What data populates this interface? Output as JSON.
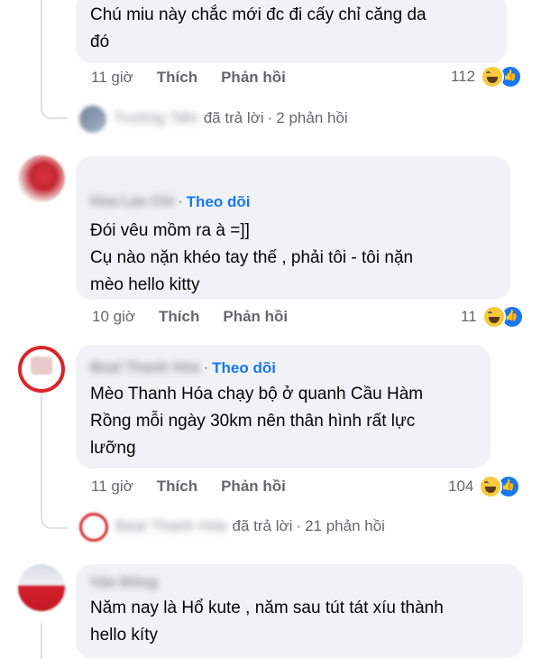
{
  "comments": [
    {
      "text_lines": [
        "Chú miu này chắc mới đc đi cấy chỉ căng da",
        "đó"
      ],
      "time": "11 giờ",
      "like": "Thích",
      "reply": "Phản hồi",
      "reaction_count": "112"
    },
    {
      "author": "Hoa Lan Chi",
      "follow": "Theo dõi",
      "text_lines": [
        "Đói vêu mồm ra à =]]",
        "Cụ nào nặn khéo tay thế , phải tôi - tôi nặn",
        "mèo hello kitty"
      ],
      "time": "10 giờ",
      "like": "Thích",
      "reply": "Phản hồi",
      "reaction_count": "11"
    },
    {
      "author": "Beat Thanh Hóa",
      "follow": "Theo dõi",
      "text_lines": [
        "Mèo Thanh Hóa chạy bộ ở quanh Cầu Hàm",
        "Rồng mỗi ngày 30km nên thân hình rất lực",
        "lưỡng"
      ],
      "time": "11 giờ",
      "like": "Thích",
      "reply": "Phản hồi",
      "reaction_count": "104"
    },
    {
      "author": "Văn Đông",
      "text_lines": [
        "Năm nay là Hổ kute , năm sau tút tát xíu thành",
        "hello kíty"
      ]
    }
  ],
  "reply_summaries": [
    {
      "name": "Trường Tiến",
      "replied": "đã trả lời",
      "count": "2 phản hồi"
    },
    {
      "name": "Beat Thanh Hóa",
      "replied": "đã trả lời",
      "count": "21 phản hồi"
    }
  ],
  "colors": {
    "link": "#1877f2",
    "bubble": "#f0f2f5",
    "meta": "#65676b"
  }
}
